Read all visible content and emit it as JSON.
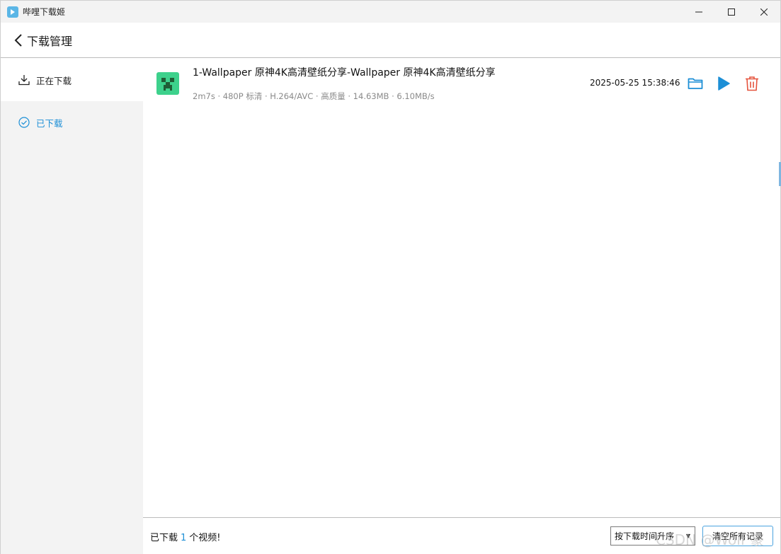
{
  "window": {
    "title": "哔哩下载姬"
  },
  "header": {
    "title": "下载管理"
  },
  "sidebar": {
    "items": [
      {
        "label": "正在下载",
        "icon": "download-icon"
      },
      {
        "label": "已下载",
        "icon": "check-circle-icon"
      }
    ]
  },
  "downloads": [
    {
      "title": "1-Wallpaper 原神4K高清壁纸分享-Wallpaper 原神4K高清壁纸分享",
      "meta": "2m7s · 480P 标清 · H.264/AVC · 高质量 · 14.63MB · 6.10MB/s",
      "time": "2025-05-25 15:38:46",
      "thumbnail_icon": "creeper-icon",
      "actions": [
        "folder-icon",
        "play-icon",
        "trash-icon"
      ]
    }
  ],
  "footer": {
    "summary_prefix": "已下载",
    "count": "1",
    "summary_suffix": "个视频!",
    "sort_value": "按下载时间升序",
    "clear_label": "清空所有记录"
  },
  "watermark": "CSDN @Wolf 豪",
  "colors": {
    "accent": "#1d8fd6",
    "delete": "#e5533d",
    "play": "#1d8fd6"
  }
}
